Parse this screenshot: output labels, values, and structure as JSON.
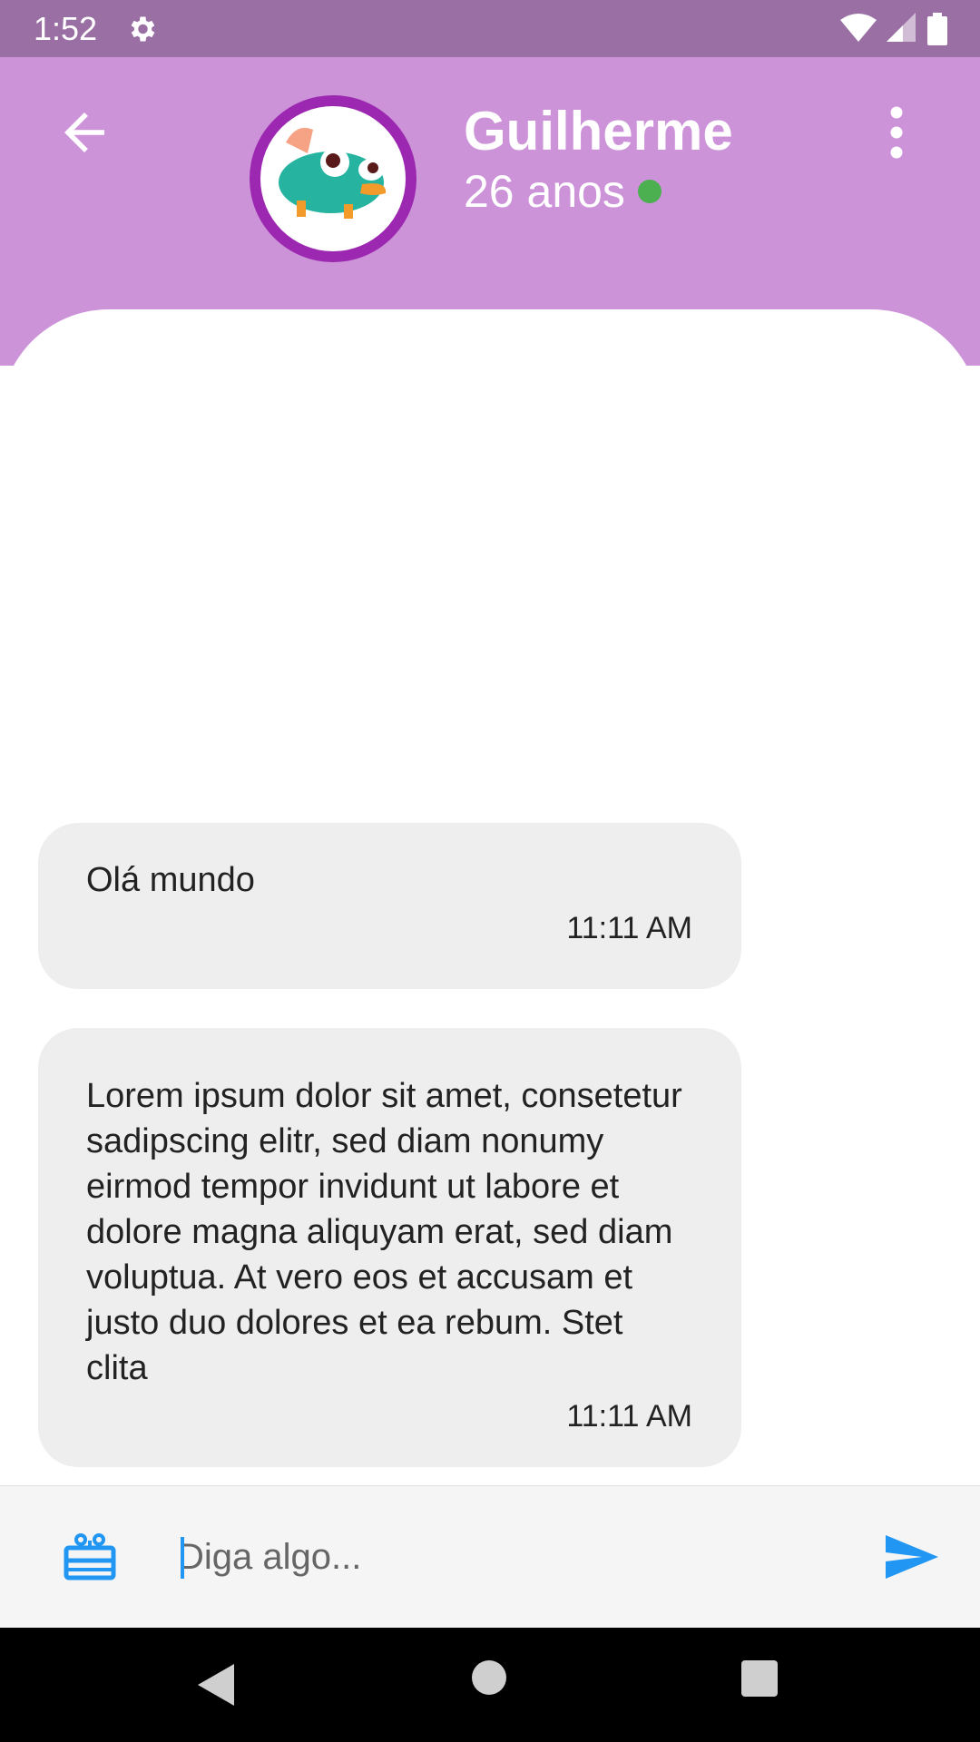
{
  "status_bar": {
    "time": "1:52",
    "icons": [
      "gear-icon",
      "wifi-icon",
      "cell-signal-icon",
      "battery-icon"
    ]
  },
  "header": {
    "name": "Guilherme",
    "age": "26 anos",
    "online": true,
    "colors": {
      "header_bg": "#cc93d9",
      "avatar_ring": "#9c27b0",
      "online_dot": "#4caf50"
    }
  },
  "messages": [
    {
      "text": "Olá mundo",
      "time": "11:11 AM"
    },
    {
      "text": "Lorem ipsum dolor sit amet, consetetur sadipscing elitr, sed diam nonumy eirmod tempor invidunt ut labore et dolore magna aliquyam erat, sed diam voluptua. At vero eos et accusam et justo duo dolores et ea rebum. Stet clita",
      "time": "11:11 AM"
    }
  ],
  "composer": {
    "placeholder": "Diga algo...",
    "value": "",
    "accent": "#2196f3"
  },
  "nav_bar": {
    "icons": [
      "back-triangle-icon",
      "home-circle-icon",
      "recents-square-icon"
    ]
  }
}
